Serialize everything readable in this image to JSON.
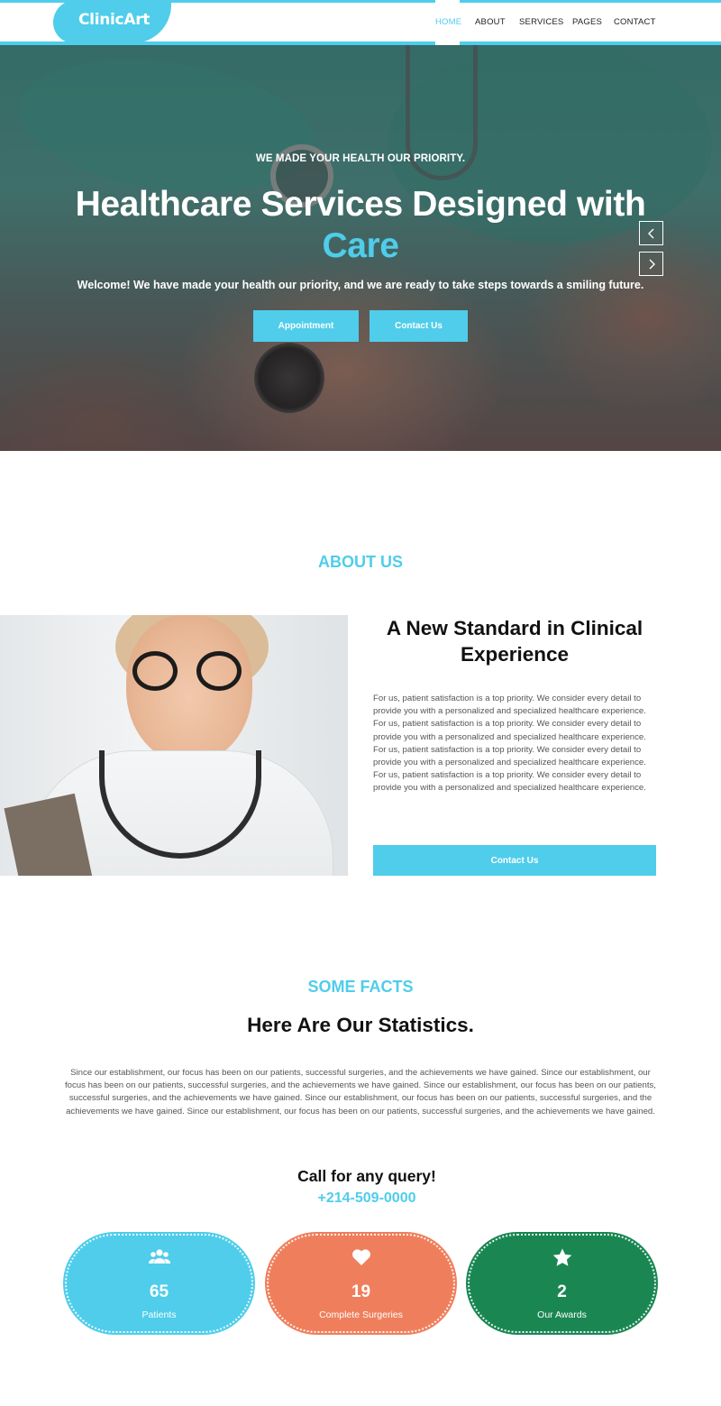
{
  "brand": {
    "name": "ClinicArt",
    "accent": "#4fcdeb"
  },
  "nav": {
    "items": [
      {
        "label": "HOME",
        "active": true
      },
      {
        "label": "ABOUT",
        "active": false
      },
      {
        "label": "SERVICES",
        "active": false
      },
      {
        "label": "PAGES",
        "active": false
      },
      {
        "label": "CONTACT",
        "active": false
      }
    ]
  },
  "hero": {
    "kicker": "WE MADE YOUR HEALTH OUR PRIORITY.",
    "title_line1": "Healthcare Services Designed with",
    "title_accent": "Care",
    "subtitle": "Welcome! We have made your health our priority, and we are ready to take steps towards a smiling future.",
    "btn_primary": "Appointment",
    "btn_secondary": "Contact Us",
    "prev_icon": "chevron-left-icon",
    "next_icon": "chevron-right-icon"
  },
  "about": {
    "kicker": "ABOUT US",
    "heading": "A New Standard in Clinical Experience",
    "body": "For us, patient satisfaction is a top priority. We consider every detail to provide you with a personalized and specialized healthcare experience. For us, patient satisfaction is a top priority. We consider every detail to provide you with a personalized and specialized healthcare experience. For us, patient satisfaction is a top priority. We consider every detail to provide you with a personalized and specialized healthcare experience. For us, patient satisfaction is a top priority. We consider every detail to provide you with a personalized and specialized healthcare experience.",
    "button": "Contact Us"
  },
  "facts": {
    "kicker": "SOME FACTS",
    "heading": "Here Are Our Statistics.",
    "body": "Since our establishment, our focus has been on our patients, successful surgeries, and the achievements we have gained. Since our establishment, our focus has been on our patients, successful surgeries, and the achievements we have gained. Since our establishment, our focus has been on our patients, successful surgeries, and the achievements we have gained. Since our establishment, our focus has been on our patients, successful surgeries, and the achievements we have gained. Since our establishment, our focus has been on our patients, successful surgeries, and the achievements we have gained.",
    "query_title": "Call for any query!",
    "query_phone": "+214-509-0000",
    "stats": [
      {
        "icon": "users-icon",
        "value": "65",
        "label": "Patients",
        "color": "#4fcdeb"
      },
      {
        "icon": "heart-icon",
        "value": "19",
        "label": "Complete Surgeries",
        "color": "#ef7f5c"
      },
      {
        "icon": "star-icon",
        "value": "2",
        "label": "Our Awards",
        "color": "#1a8753"
      }
    ]
  }
}
